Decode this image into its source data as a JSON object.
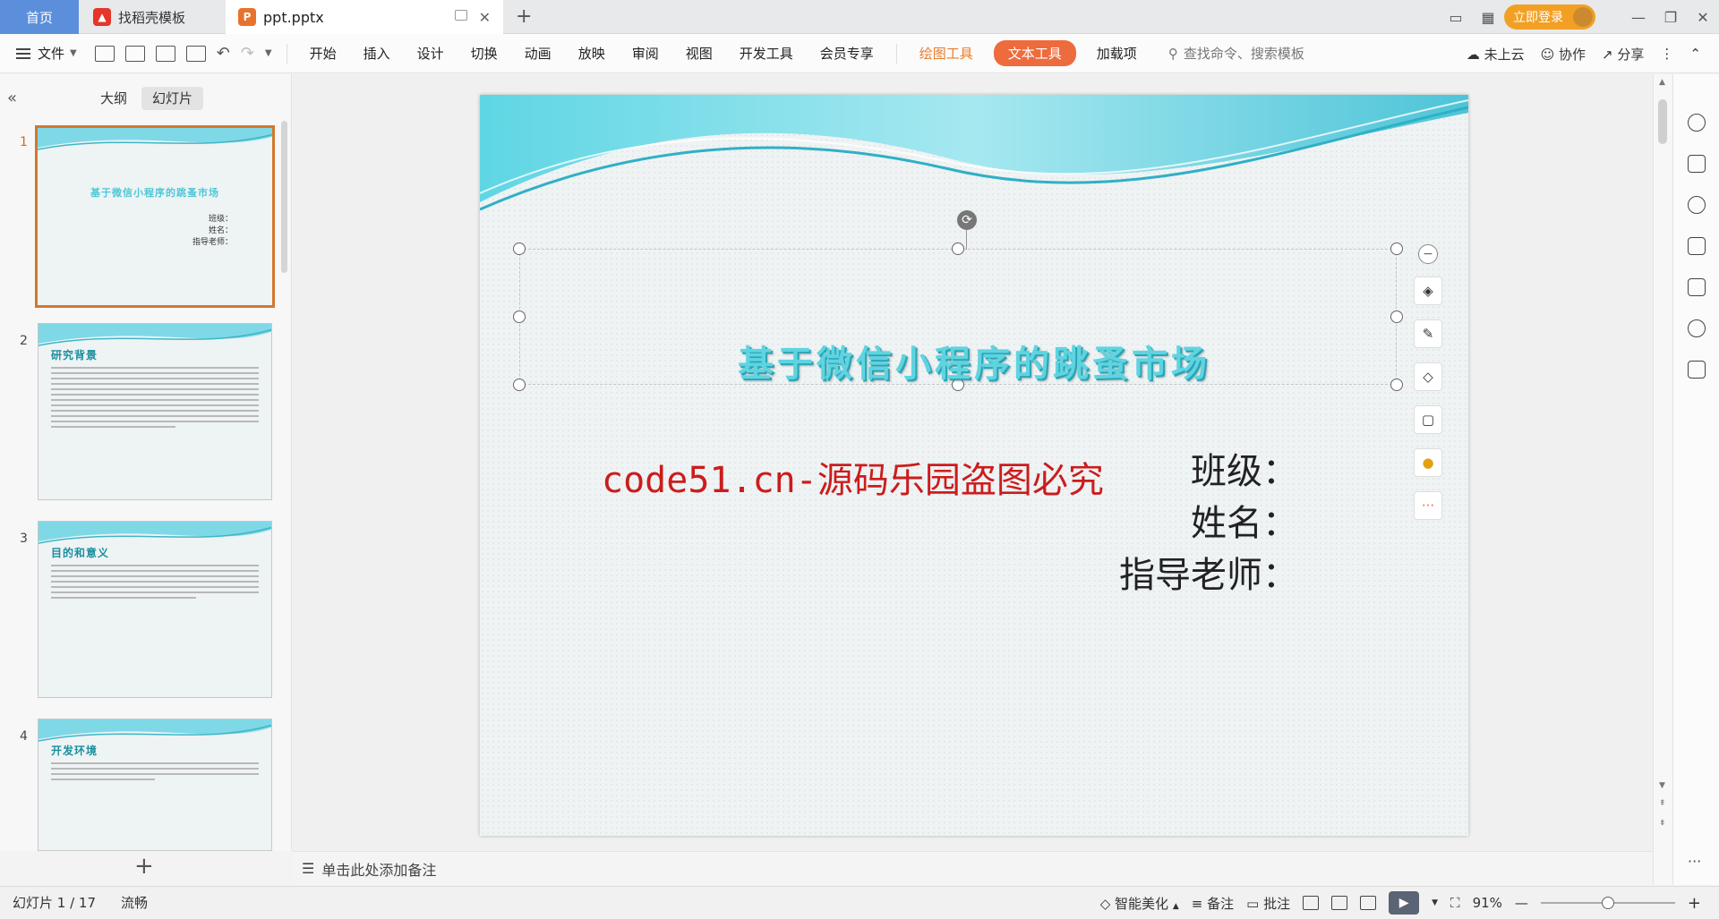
{
  "tabs": {
    "home": "首页",
    "template": "找稻壳模板",
    "document": "ppt.pptx"
  },
  "header": {
    "login": "立即登录"
  },
  "ribbon": {
    "file": "文件",
    "menus": [
      "开始",
      "插入",
      "设计",
      "切换",
      "动画",
      "放映",
      "审阅",
      "视图",
      "开发工具",
      "会员专享"
    ],
    "draw_tools": "绘图工具",
    "text_tools": "文本工具",
    "addins": "加载项",
    "search_placeholder": "查找命令、搜索模板",
    "cloud": "未上云",
    "collab": "协作",
    "share": "分享"
  },
  "panel": {
    "outline_tab": "大纲",
    "slides_tab": "幻灯片",
    "thumbnails": [
      {
        "num": "1",
        "title": "基于微信小程序的跳蚤市场",
        "info": [
          "班级：",
          "姓名：",
          "指导老师："
        ]
      },
      {
        "num": "2",
        "title": "研究背景"
      },
      {
        "num": "3",
        "title": "目的和意义"
      },
      {
        "num": "4",
        "title": "开发环境"
      }
    ]
  },
  "slide": {
    "title": "基于微信小程序的跳蚤市场",
    "watermark": "code51.cn-源码乐园盗图必究",
    "class_label": "班级：",
    "name_label": "姓名：",
    "teacher_label": "指导老师："
  },
  "notes": {
    "placeholder": "单击此处添加备注"
  },
  "status": {
    "slide_counter": "幻灯片 1 / 17",
    "mode": "流畅",
    "beautify": "智能美化",
    "notes": "备注",
    "comments": "批注",
    "zoom": "91%",
    "zoom_level": 0.5
  },
  "colors": {
    "accent_orange": "#ee6b3e",
    "home_tab": "#5b8fdb",
    "title_teal": "#5fd4e0",
    "watermark_red": "#cc1c1c"
  }
}
